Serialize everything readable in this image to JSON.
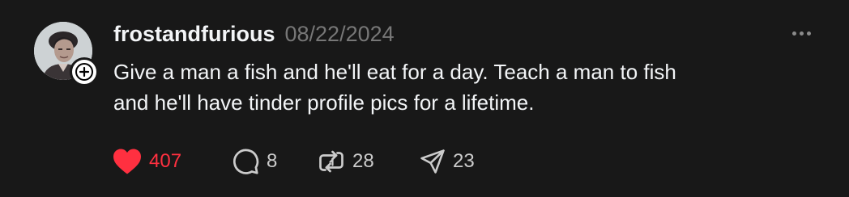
{
  "post": {
    "username": "frostandfurious",
    "timestamp": "08/22/2024",
    "text_lines": [
      "Give a man a fish and he'll eat for a day. Teach a man to fish",
      "and he'll have tinder profile pics for a lifetime."
    ],
    "liked": true,
    "counts": {
      "likes": "407",
      "replies": "8",
      "reposts": "28",
      "shares": "23"
    }
  },
  "icons": {
    "avatar": "user-avatar",
    "follow": "plus-icon",
    "more": "more-horizontal-icon",
    "like": "heart-filled-icon",
    "reply": "speech-bubble-icon",
    "repost": "repost-arrows-icon",
    "share": "paper-plane-icon"
  },
  "colors": {
    "background": "#181818",
    "primary_text": "#f3f5f7",
    "secondary_text": "#777777",
    "like_accent": "#ff3040",
    "count_text": "#cccccc"
  }
}
